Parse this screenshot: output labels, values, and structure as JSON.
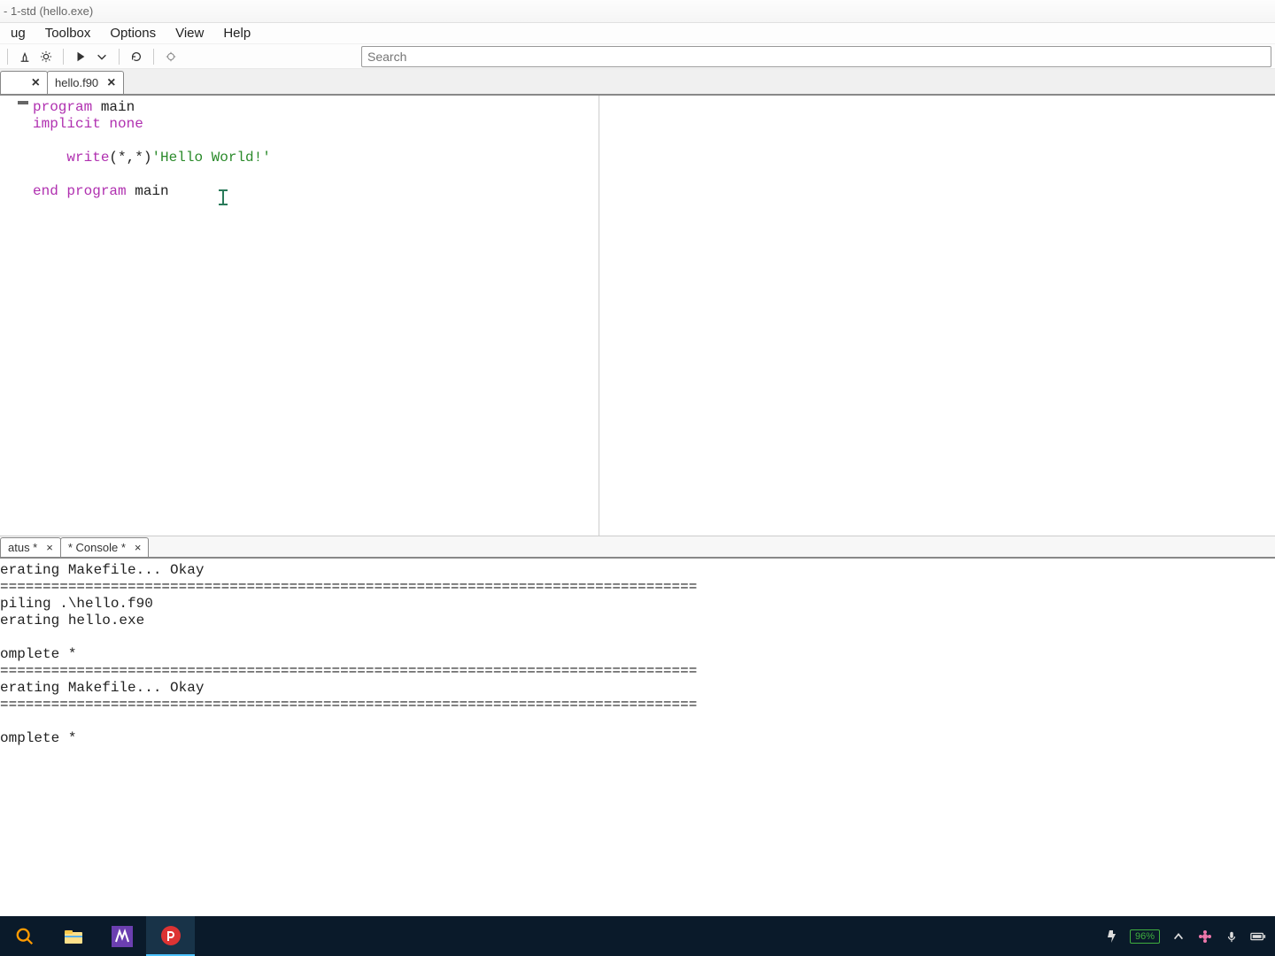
{
  "window": {
    "title": "- 1-std (hello.exe)"
  },
  "menu": {
    "items": [
      "ug",
      "Toolbox",
      "Options",
      "View",
      "Help"
    ]
  },
  "search": {
    "placeholder": "Search"
  },
  "tabs": {
    "first_close_only": true,
    "second": {
      "label": "hello.f90"
    }
  },
  "code": {
    "line1_kw": "program",
    "line1_rest": " main",
    "line2_kw": "implicit none",
    "line4_indent": "    ",
    "line4_kw": "write",
    "line4_args": "(*,*)",
    "line4_str": "'Hello World!'",
    "line6_a": "end ",
    "line6_b": "program",
    "line6_c": " main"
  },
  "bottom_tabs": {
    "first": "atus *",
    "second": "* Console *"
  },
  "console_text": "erating Makefile... Okay\n==================================================================================\npiling .\\hello.f90\nerating hello.exe\n\nomplete *\n==================================================================================\nerating Makefile... Okay\n==================================================================================\n\nomplete *",
  "systray": {
    "battery": "96%"
  }
}
